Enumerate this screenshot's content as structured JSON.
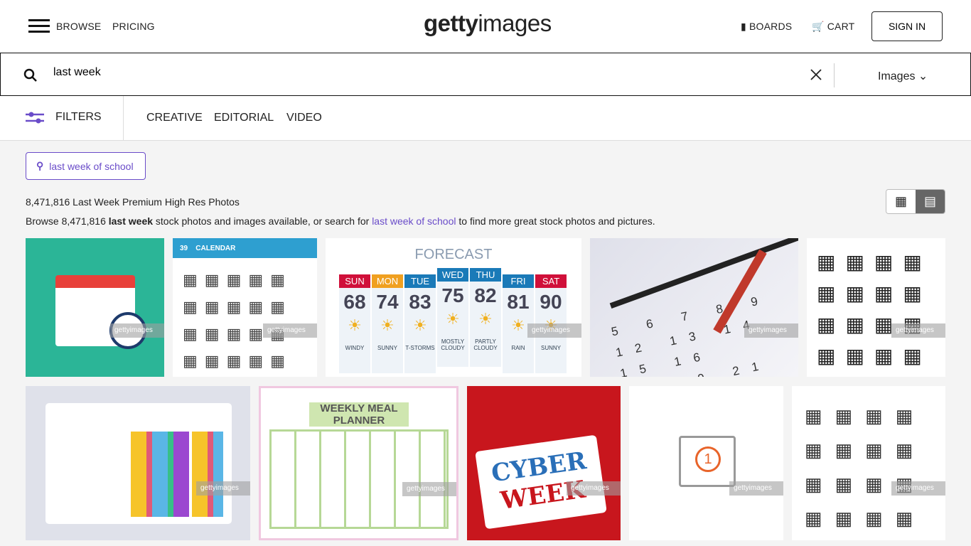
{
  "header": {
    "browse": "BROWSE",
    "pricing": "PRICING",
    "logo_bold": "getty",
    "logo_light": "images",
    "boards": "BOARDS",
    "cart": "CART",
    "sign_in": "SIGN IN"
  },
  "search": {
    "value": "last week",
    "type": "Images"
  },
  "filters": {
    "label": "FILTERS",
    "tabs": [
      "CREATIVE",
      "EDITORIAL",
      "VIDEO"
    ]
  },
  "suggestion": "last week of school",
  "results": {
    "count_title": "8,471,816 Last Week Premium High Res Photos",
    "desc_pre": "Browse 8,471,816 ",
    "desc_bold": "last week",
    "desc_mid": " stock photos and images available, or search for ",
    "desc_link": "last week of school",
    "desc_post": " to find more great stock photos and pictures."
  },
  "watermark": "gettyimages",
  "accent": "#6a4cc9",
  "tiles": {
    "calendar_header": {
      "num": "39",
      "label": "CALENDAR"
    },
    "forecast": {
      "title": "FORECAST",
      "days": [
        {
          "d": "SUN",
          "t": "68",
          "w": "WINDY",
          "c": "#d0103a"
        },
        {
          "d": "MON",
          "t": "74",
          "w": "SUNNY",
          "c": "#f0a020"
        },
        {
          "d": "TUE",
          "t": "83",
          "w": "T-STORMS",
          "c": "#1a7ab8"
        },
        {
          "d": "WED",
          "t": "75",
          "w": "MOSTLY CLOUDY",
          "c": "#1a7ab8"
        },
        {
          "d": "THU",
          "t": "82",
          "w": "PARTLY CLOUDY",
          "c": "#1a7ab8"
        },
        {
          "d": "FRI",
          "t": "81",
          "w": "RAIN",
          "c": "#1a7ab8"
        },
        {
          "d": "SAT",
          "t": "90",
          "w": "SUNNY",
          "c": "#d0103a"
        }
      ]
    },
    "meal_planner": "WEEKLY MEAL PLANNER",
    "cyber": [
      "CYBER",
      "WEEK"
    ]
  }
}
